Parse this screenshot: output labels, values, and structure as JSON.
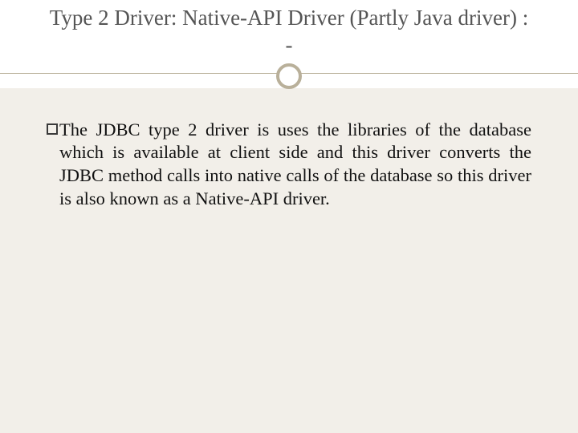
{
  "slide": {
    "title": "Type 2 Driver: Native-API Driver (Partly Java driver) : -",
    "bullets": [
      {
        "text": "The JDBC type 2 driver is uses the libraries of the database which is available at client side and this driver converts the JDBC method calls into native calls of the database  so this driver is also known as a Native-API driver."
      }
    ]
  }
}
